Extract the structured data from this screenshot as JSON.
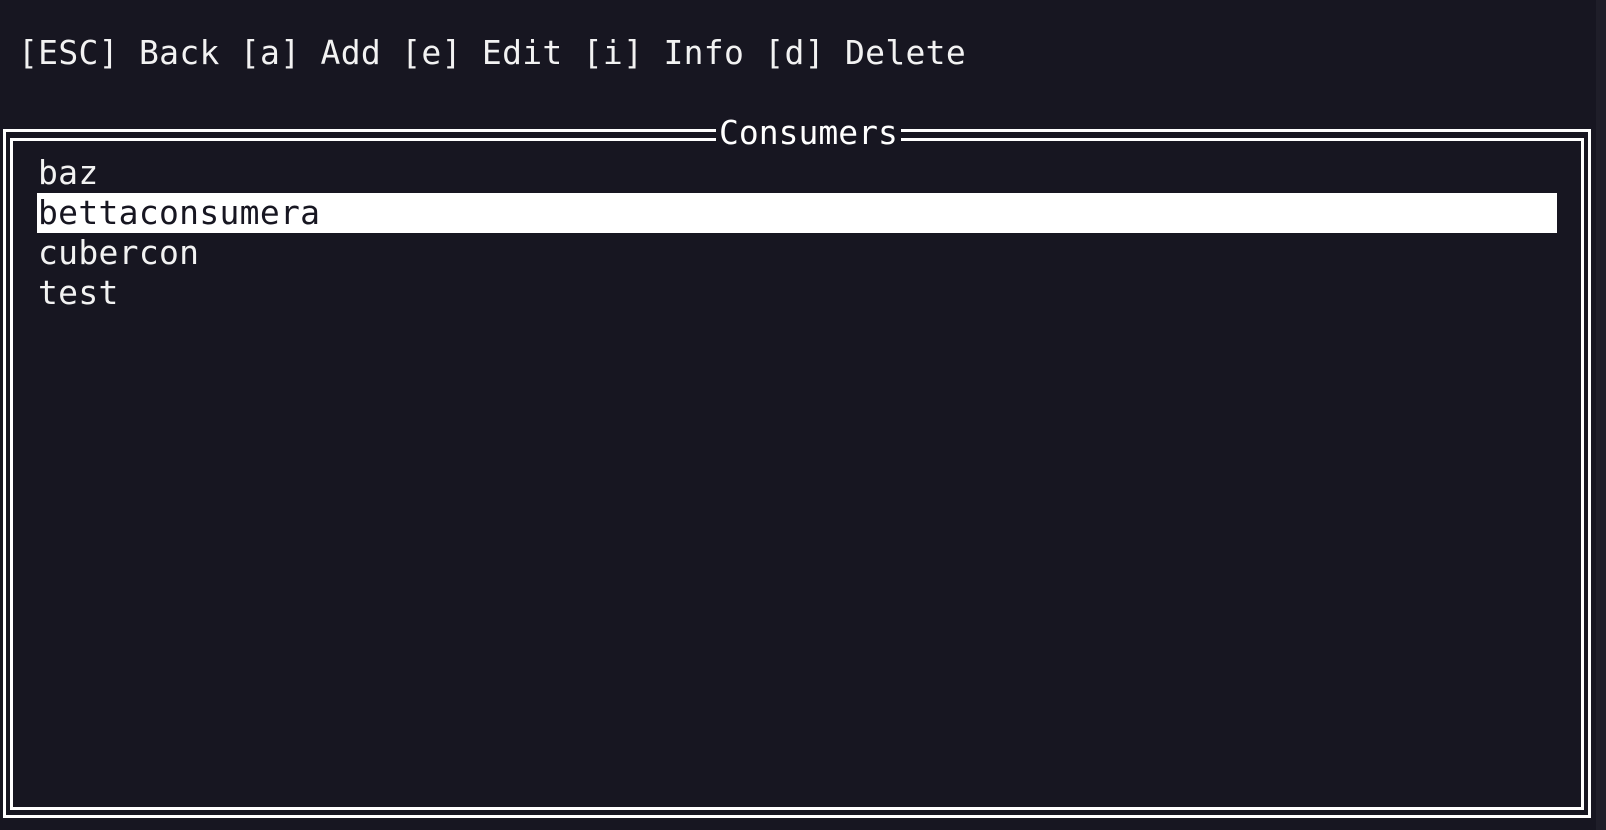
{
  "help_bar": {
    "items": [
      {
        "key": "[ESC]",
        "label": "Back"
      },
      {
        "key": "[a]",
        "label": "Add"
      },
      {
        "key": "[e]",
        "label": "Edit"
      },
      {
        "key": "[i]",
        "label": "Info"
      },
      {
        "key": "[d]",
        "label": "Delete"
      }
    ]
  },
  "panel": {
    "title": "Consumers",
    "items": [
      {
        "label": "baz",
        "selected": false
      },
      {
        "label": "bettaconsumera",
        "selected": true
      },
      {
        "label": "cubercon",
        "selected": false
      },
      {
        "label": "test",
        "selected": false
      }
    ]
  },
  "colors": {
    "background": "#171621",
    "foreground": "#f2f2f2",
    "selection_bg": "#ffffff",
    "selection_fg": "#171621",
    "border": "#ffffff"
  }
}
